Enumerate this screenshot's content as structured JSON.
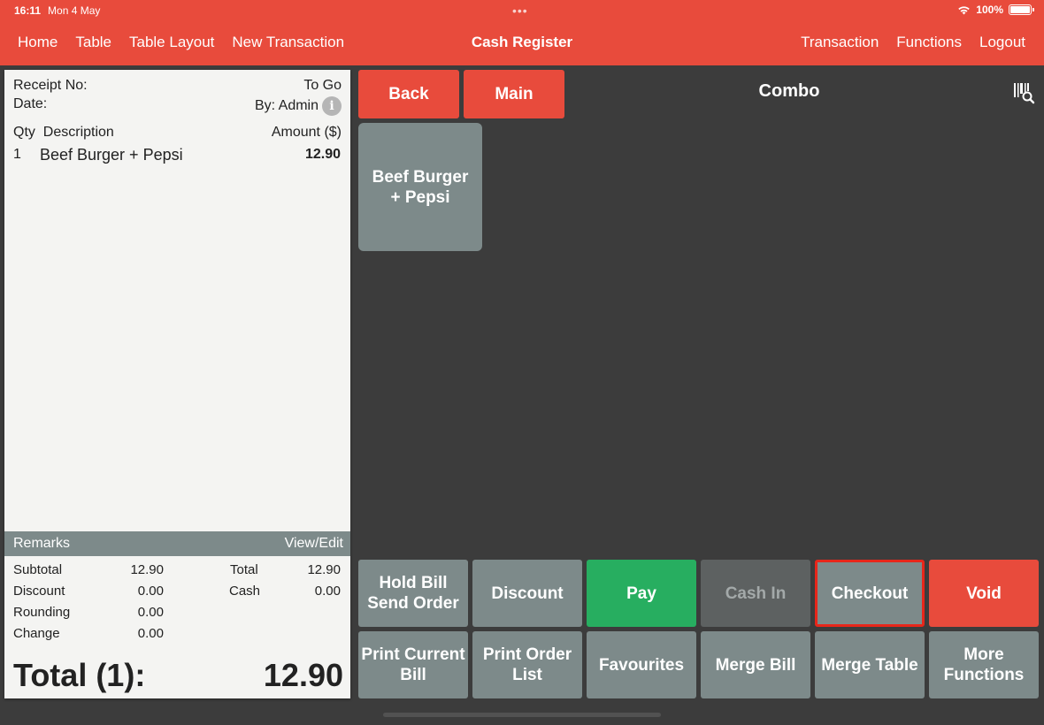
{
  "status": {
    "time": "16:11",
    "date": "Mon 4 May",
    "battery": "100%"
  },
  "nav": {
    "left": [
      "Home",
      "Table",
      "Table Layout",
      "New Transaction"
    ],
    "title": "Cash Register",
    "right": [
      "Transaction",
      "Functions",
      "Logout"
    ]
  },
  "receipt": {
    "receipt_no_label": "Receipt No:",
    "order_type": "To Go",
    "date_label": "Date:",
    "by": "By: Admin",
    "qty_header": "Qty",
    "desc_header": "Description",
    "amount_header": "Amount ($)",
    "items": [
      {
        "qty": "1",
        "description": "Beef Burger + Pepsi",
        "amount": "12.90"
      }
    ],
    "remarks_label": "Remarks",
    "view_edit": "View/Edit",
    "subtotal_label": "Subtotal",
    "subtotal": "12.90",
    "discount_label": "Discount",
    "discount": "0.00",
    "rounding_label": "Rounding",
    "rounding": "0.00",
    "change_label": "Change",
    "change": "0.00",
    "total_label": "Total",
    "total": "12.90",
    "cash_label": "Cash",
    "cash": "0.00",
    "grand_total_label": "Total (1):",
    "grand_total": "12.90"
  },
  "menu": {
    "back": "Back",
    "main": "Main",
    "category_title": "Combo",
    "products": [
      "Beef Burger\n+ Pepsi"
    ]
  },
  "functions": {
    "hold_bill": "Hold Bill\nSend Order",
    "discount": "Discount",
    "pay": "Pay",
    "cash_in": "Cash In",
    "checkout": "Checkout",
    "void": "Void",
    "print_current_bill": "Print Current\nBill",
    "print_order_list": "Print Order\nList",
    "favourites": "Favourites",
    "merge_bill": "Merge Bill",
    "merge_table": "Merge Table",
    "more_functions": "More\nFunctions"
  },
  "colors": {
    "accent": "#e84b3c",
    "button_gray": "#7d8a8a",
    "pay_green": "#27ae60",
    "background": "#3c3c3c",
    "highlight": "#e8261a"
  }
}
